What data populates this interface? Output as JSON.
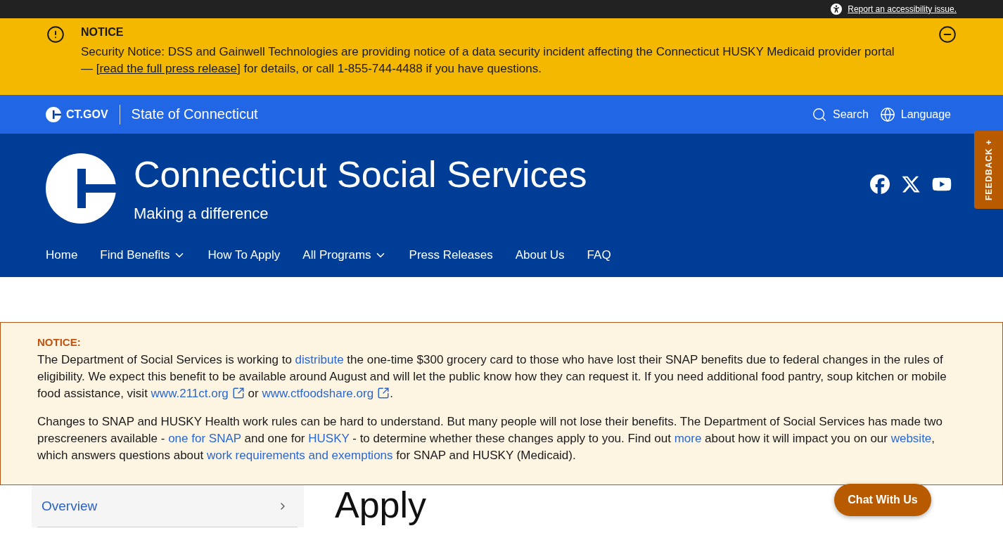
{
  "top_bar": {
    "accessibility_link": "Report an accessibility issue."
  },
  "alert": {
    "title": "NOTICE",
    "expanded": true,
    "message": [
      {
        "kind": "text",
        "text": "Security Notice: DSS and Gainwell Technologies are providing notice of a data security incident affecting the Connecticut HUSKY Medicaid provider portal — ["
      },
      {
        "kind": "link",
        "text": "read the full press release"
      },
      {
        "kind": "text",
        "text": "] for details, or call 1-855-744-4488 if you have questions."
      }
    ]
  },
  "state_bar": {
    "logo_text": "CT.GOV",
    "site_name": "State of Connecticut",
    "actions": [
      {
        "kind": "search",
        "label": "Search"
      },
      {
        "kind": "language",
        "label": "Language"
      }
    ]
  },
  "header": {
    "title": "Connecticut Social Services",
    "tagline": "Making a difference",
    "social": [
      {
        "kind": "facebook"
      },
      {
        "kind": "x"
      },
      {
        "kind": "youtube"
      }
    ]
  },
  "nav": [
    {
      "kind": "link",
      "label": "Home"
    },
    {
      "kind": "menu",
      "label": "Find Benefits"
    },
    {
      "kind": "link",
      "label": "How To Apply"
    },
    {
      "kind": "menu",
      "label": "All Programs"
    },
    {
      "kind": "link",
      "label": "Press Releases"
    },
    {
      "kind": "link",
      "label": "About Us"
    },
    {
      "kind": "link",
      "label": "FAQ"
    }
  ],
  "feedback": {
    "label": "FEEDBACK +"
  },
  "notice": {
    "title": "NOTICE:",
    "paragraphs": [
      [
        {
          "kind": "text",
          "text": "The Department of Social Services is working to "
        },
        {
          "kind": "link",
          "text": "distribute"
        },
        {
          "kind": "text",
          "text": " the one-time $300 grocery card to those who have lost their SNAP benefits due to federal changes in the rules of eligibility. We expect this benefit to be available around August and will let the public know how they can request it. If you need additional food pantry, soup kitchen or mobile food assistance, visit "
        },
        {
          "kind": "external_link",
          "text": "www.211ct.org"
        },
        {
          "kind": "text",
          "text": " or "
        },
        {
          "kind": "external_link",
          "text": "www.ctfoodshare.org"
        },
        {
          "kind": "text",
          "text": "."
        }
      ],
      [
        {
          "kind": "text",
          "text": "Changes to SNAP and HUSKY Health work rules can be hard to understand. But many people will not lose their benefits. The Department of Social Services has made two prescreeners available - "
        },
        {
          "kind": "link",
          "text": "one for SNAP"
        },
        {
          "kind": "text",
          "text": " and one for "
        },
        {
          "kind": "link",
          "text": "HUSKY"
        },
        {
          "kind": "text",
          "text": " - to determine whether these changes apply to you. Find out "
        },
        {
          "kind": "link",
          "text": "more"
        },
        {
          "kind": "text",
          "text": " about how it will impact you on our "
        },
        {
          "kind": "link",
          "text": "website"
        },
        {
          "kind": "text",
          "text": ", which answers questions about "
        },
        {
          "kind": "link",
          "text": "work requirements and exemptions"
        },
        {
          "kind": "text",
          "text": " for SNAP and HUSKY (Medicaid)."
        }
      ]
    ]
  },
  "sidebar": {
    "items": [
      {
        "label": "Overview"
      }
    ]
  },
  "main": {
    "heading": "Apply"
  },
  "chat_button": {
    "label": "Chat With Us"
  }
}
